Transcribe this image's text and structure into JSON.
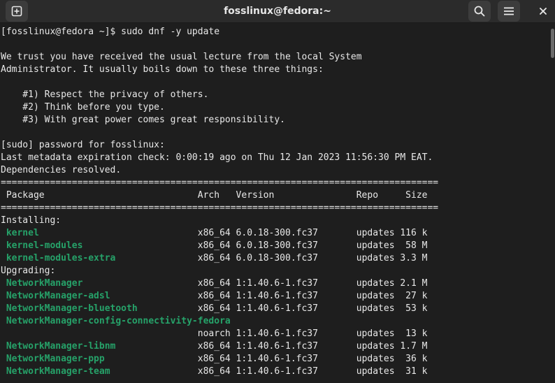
{
  "window": {
    "title": "fosslinux@fedora:~",
    "colors": {
      "background": "#1e1e1e",
      "titlebar": "#2b2b2b",
      "text": "#e8e8e8",
      "package_name": "#26a269"
    },
    "icons": [
      "new-tab-icon",
      "search-icon",
      "hamburger-menu-icon",
      "close-icon"
    ]
  },
  "terminal": {
    "lines": [
      {
        "text": "[fosslinux@fedora ~]$ sudo dnf -y update"
      },
      {
        "text": ""
      },
      {
        "text": "We trust you have received the usual lecture from the local System"
      },
      {
        "text": "Administrator. It usually boils down to these three things:"
      },
      {
        "text": ""
      },
      {
        "text": "    #1) Respect the privacy of others."
      },
      {
        "text": "    #2) Think before you type."
      },
      {
        "text": "    #3) With great power comes great responsibility."
      },
      {
        "text": ""
      },
      {
        "text": "[sudo] password for fosslinux:"
      },
      {
        "text": "Last metadata expiration check: 0:00:19 ago on Thu 12 Jan 2023 11:56:30 PM EAT."
      },
      {
        "text": "Dependencies resolved."
      },
      {
        "text": "================================================================================"
      },
      {
        "text": " Package                            Arch   Version               Repo     Size"
      },
      {
        "text": "================================================================================"
      },
      {
        "text": "Installing:"
      },
      {
        "pkg": " kernel",
        "rest": "                             x86_64 6.0.18-300.fc37       updates 116 k"
      },
      {
        "pkg": " kernel-modules",
        "rest": "                     x86_64 6.0.18-300.fc37       updates  58 M"
      },
      {
        "pkg": " kernel-modules-extra",
        "rest": "               x86_64 6.0.18-300.fc37       updates 3.3 M"
      },
      {
        "text": "Upgrading:"
      },
      {
        "pkg": " NetworkManager",
        "rest": "                     x86_64 1:1.40.6-1.fc37       updates 2.1 M"
      },
      {
        "pkg": " NetworkManager-adsl",
        "rest": "                x86_64 1:1.40.6-1.fc37       updates  27 k"
      },
      {
        "pkg": " NetworkManager-bluetooth",
        "rest": "           x86_64 1:1.40.6-1.fc37       updates  53 k"
      },
      {
        "pkg": " NetworkManager-config-connectivity-fedora",
        "rest": ""
      },
      {
        "text": "                                    noarch 1:1.40.6-1.fc37       updates  13 k"
      },
      {
        "pkg": " NetworkManager-libnm",
        "rest": "               x86_64 1:1.40.6-1.fc37       updates 1.7 M"
      },
      {
        "pkg": " NetworkManager-ppp",
        "rest": "                 x86_64 1:1.40.6-1.fc37       updates  36 k"
      },
      {
        "pkg": " NetworkManager-team",
        "rest": "                x86_64 1:1.40.6-1.fc37       updates  31 k"
      }
    ]
  }
}
